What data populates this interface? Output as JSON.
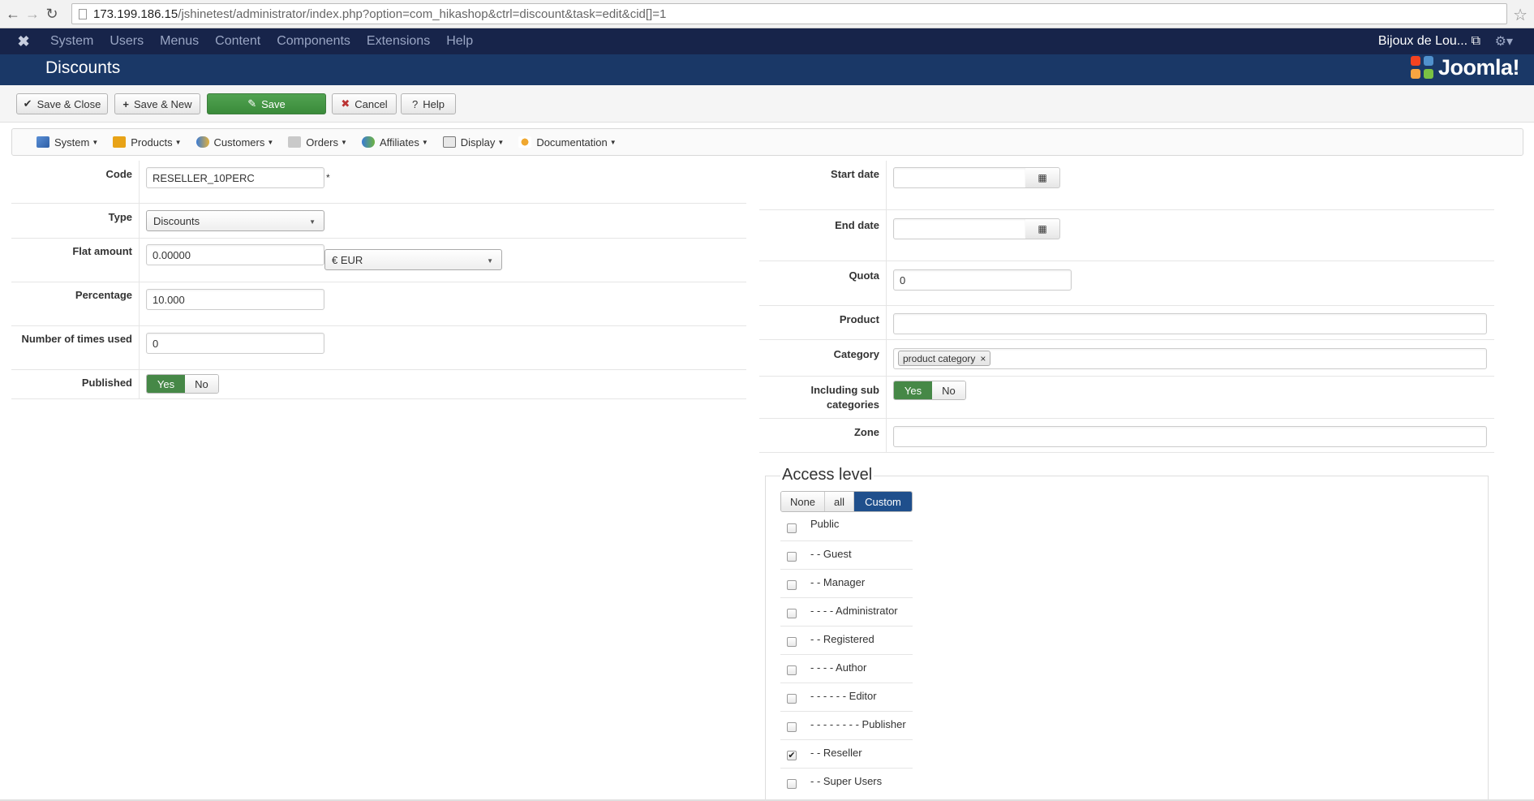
{
  "browser": {
    "url_host": "173.199.186.15",
    "url_path": "/jshinetest/administrator/index.php?option=com_hikashop&ctrl=discount&task=edit&cid[]=1"
  },
  "topmenu": {
    "items": [
      "System",
      "Users",
      "Menus",
      "Content",
      "Components",
      "Extensions",
      "Help"
    ],
    "site_name": "Bijoux de Lou... ⧉"
  },
  "header": {
    "title": "Discounts",
    "logo_text": "Joomla!"
  },
  "toolbar": {
    "save_close": "Save & Close",
    "save_new": "Save & New",
    "save": "Save",
    "cancel": "Cancel",
    "help": "Help"
  },
  "hikamenu": {
    "items": [
      "System",
      "Products",
      "Customers",
      "Orders",
      "Affiliates",
      "Display",
      "Documentation"
    ]
  },
  "form_left": {
    "code_label": "Code",
    "code_value": "RESELLER_10PERC",
    "required_mark": "*",
    "type_label": "Type",
    "type_value": "Discounts",
    "flat_label": "Flat amount",
    "flat_value": "0.00000",
    "currency_value": "€ EUR",
    "percentage_label": "Percentage",
    "percentage_value": "10.000",
    "times_used_label": "Number of times used",
    "times_used_value": "0",
    "published_label": "Published",
    "yes": "Yes",
    "no": "No",
    "published_state": "Yes"
  },
  "form_right": {
    "start_label": "Start date",
    "start_value": "",
    "end_label": "End date",
    "end_value": "",
    "quota_label": "Quota",
    "quota_value": "0",
    "product_label": "Product",
    "product_value": "",
    "category_label": "Category",
    "category_tag": "product category",
    "subcat_label_1": "Including sub",
    "subcat_label_2": "categories",
    "subcat_state": "Yes",
    "zone_label": "Zone",
    "zone_value": ""
  },
  "access": {
    "legend": "Access level",
    "modes": [
      "None",
      "all",
      "Custom"
    ],
    "selected_mode": "Custom",
    "groups": [
      {
        "label": "Public",
        "checked": false
      },
      {
        "label": "- - Guest",
        "checked": false
      },
      {
        "label": "- - Manager",
        "checked": false
      },
      {
        "label": "- - - - Administrator",
        "checked": false
      },
      {
        "label": "- - Registered",
        "checked": false
      },
      {
        "label": "- - - - Author",
        "checked": false
      },
      {
        "label": "- - - - - - Editor",
        "checked": false
      },
      {
        "label": "- - - - - - - - Publisher",
        "checked": false
      },
      {
        "label": "- - Reseller",
        "checked": true
      },
      {
        "label": "- - Super Users",
        "checked": false
      }
    ]
  },
  "colors": {
    "top_menu_bg": "#17244a",
    "header_bg": "#1a3867",
    "save_green": "#468847",
    "custom_blue": "#1f4f8c"
  }
}
